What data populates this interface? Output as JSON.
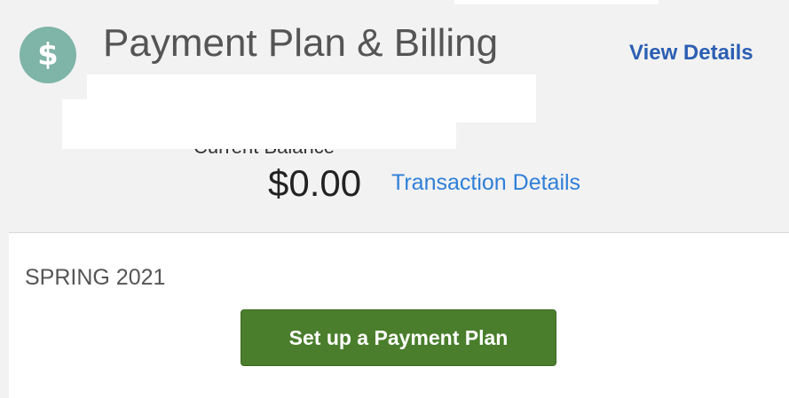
{
  "header": {
    "icon": "dollar-sign-icon",
    "icon_glyph": "$",
    "title": "Payment Plan & Billing",
    "view_details_label": "View Details"
  },
  "balance": {
    "label": "Current Balance",
    "amount": "$0.00",
    "transaction_details_label": "Transaction Details"
  },
  "term": {
    "label": "SPRING 2021",
    "setup_plan_label": "Set up a Payment Plan"
  },
  "colors": {
    "icon_circle": "#7fb4a8",
    "title_text": "#555555",
    "view_details_link": "#2b5fb3",
    "transaction_link": "#2f7fd8",
    "panel_background": "#f2f2f2",
    "button_background": "#4a7e2c"
  }
}
